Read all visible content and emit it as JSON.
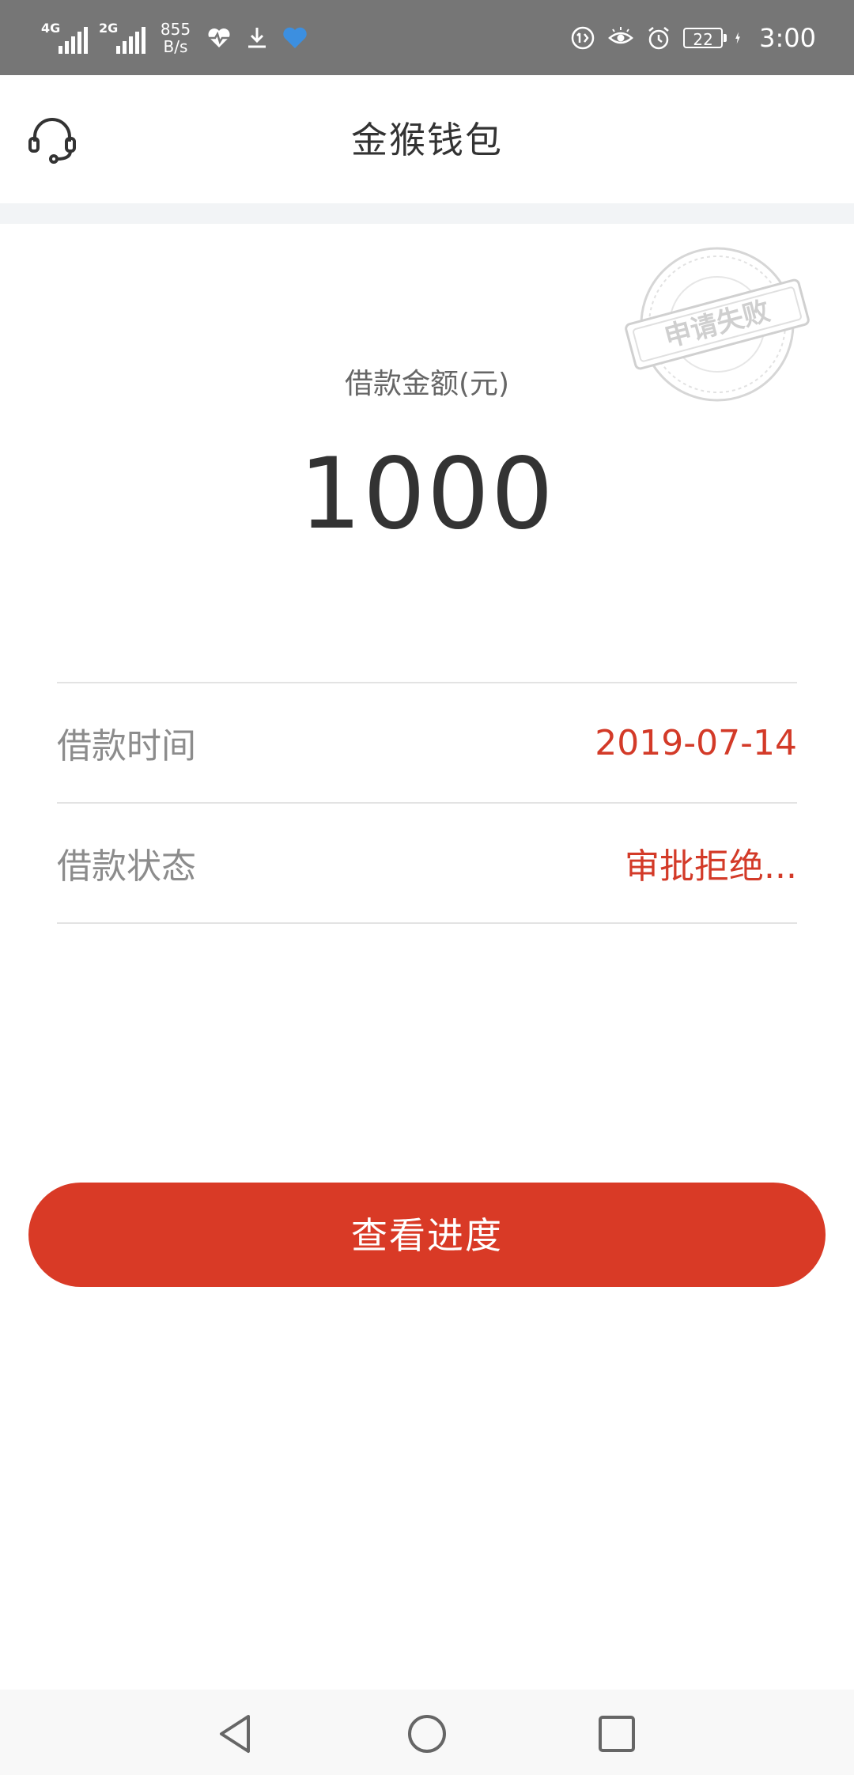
{
  "status_bar": {
    "net1": "4G",
    "net2": "2G",
    "speed_value": "855",
    "speed_unit": "B/s",
    "battery": "22",
    "time": "3:00"
  },
  "header": {
    "title": "金猴钱包",
    "left_icon": "headset-icon"
  },
  "stamp": {
    "text": "申请失败"
  },
  "loan": {
    "amount_label": "借款金额(元)",
    "amount": "1000"
  },
  "info": [
    {
      "label": "借款时间",
      "value": "2019-07-14"
    },
    {
      "label": "借款状态",
      "value": "审批拒绝..."
    }
  ],
  "actions": {
    "view_progress": "查看进度"
  },
  "colors": {
    "accent": "#d93a26",
    "value_text": "#d33a28",
    "status_bar": "#767676"
  }
}
